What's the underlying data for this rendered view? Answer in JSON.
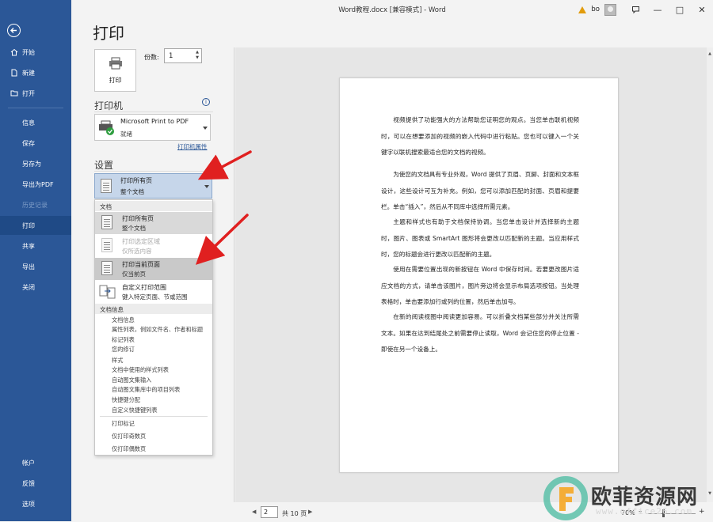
{
  "window": {
    "title": "Word教程.docx [兼容模式]  -  Word",
    "user": "bo",
    "controls": [
      "—",
      "□",
      "✕"
    ]
  },
  "sidebar": {
    "top_items": [
      {
        "label": "开始",
        "icon": "home-icon"
      },
      {
        "label": "新建",
        "icon": "new-doc-icon"
      },
      {
        "label": "打开",
        "icon": "folder-open-icon"
      }
    ],
    "mid_items": [
      {
        "label": "信息",
        "state": "normal"
      },
      {
        "label": "保存",
        "state": "normal"
      },
      {
        "label": "另存为",
        "state": "normal"
      },
      {
        "label": "导出为PDF",
        "state": "normal"
      },
      {
        "label": "历史记录",
        "state": "disabled"
      },
      {
        "label": "打印",
        "state": "active"
      },
      {
        "label": "共享",
        "state": "normal"
      },
      {
        "label": "导出",
        "state": "normal"
      },
      {
        "label": "关闭",
        "state": "normal"
      }
    ],
    "bottom_items": [
      "帐户",
      "反馈",
      "选项"
    ]
  },
  "print": {
    "heading": "打印",
    "button_label": "打印",
    "copies_label": "份数:",
    "copies_value": "1"
  },
  "printer": {
    "heading": "打印机",
    "name": "Microsoft Print to PDF",
    "status": "就绪",
    "properties_link": "打印机属性"
  },
  "settings": {
    "heading": "设置",
    "selected_line1": "打印所有页",
    "selected_line2": "整个文档"
  },
  "dropdown": {
    "doc_header": "文档",
    "options": [
      {
        "line1": "打印所有页",
        "line2": "整个文档",
        "state": "selected"
      },
      {
        "line1": "打印选定区域",
        "line2": "仅所选内容",
        "state": "disabled"
      },
      {
        "line1": "打印当前页面",
        "line2": "仅当前页",
        "state": "hover"
      },
      {
        "line1": "自定义打印范围",
        "line2": "键入特定页面、节或范围",
        "state": "normal"
      }
    ],
    "info_header": "文档信息",
    "info_items": [
      "文档信息",
      "属性列表，例如文件名、作者和标题",
      "标记列表",
      "您的修订",
      "样式",
      "文档中使用的样式列表",
      "自动图文集输入",
      "自动图文集库中的项目列表",
      "快捷键分配",
      "自定义快捷键列表"
    ],
    "extra_items": [
      "打印标记",
      "仅打印奇数页",
      "仅打印偶数页"
    ]
  },
  "document": {
    "paragraphs": [
      "视频提供了功能强大的方法帮助您证明您的观点。当您单击联机视频时，可以在想要添加的视频的嵌入代码中进行粘贴。您也可以键入一个关键字以联机搜索最适合您的文档的视频。",
      "为使您的文档具有专业外观，Word 提供了页眉、页脚、封面和文本框设计，这些设计可互为补充。例如，您可以添加匹配的封面、页眉和提要栏。单击“插入”，然后从不同库中选择所需元素。",
      "主题和样式也有助于文档保持协调。当您单击设计并选择新的主题时，图片、图表或 SmartArt 图形将会更改以匹配新的主题。当应用样式时，您的标题会进行更改以匹配新的主题。",
      "使用在需要位置出现的新按钮在 Word 中保存时间。若要更改图片适应文档的方式，请单击该图片，图片旁边将会显示布局选项按钮。当处理表格时，单击要添加行或列的位置，然后单击加号。",
      "在新的阅读视图中阅读更加容易。可以折叠文档某些部分并关注所需文本。如果在达到结尾处之前需要停止读取，Word 会记住您的停止位置 - 即使在另一个设备上。"
    ]
  },
  "pager": {
    "current": "2",
    "total_label": "共 10 页",
    "zoom": "70%"
  },
  "watermark": {
    "text": "欧菲资源网",
    "url": "www.office26.com"
  },
  "colors": {
    "sidebar": "#2b5797",
    "active": "#1f4a86",
    "arrow": "#e02020"
  }
}
